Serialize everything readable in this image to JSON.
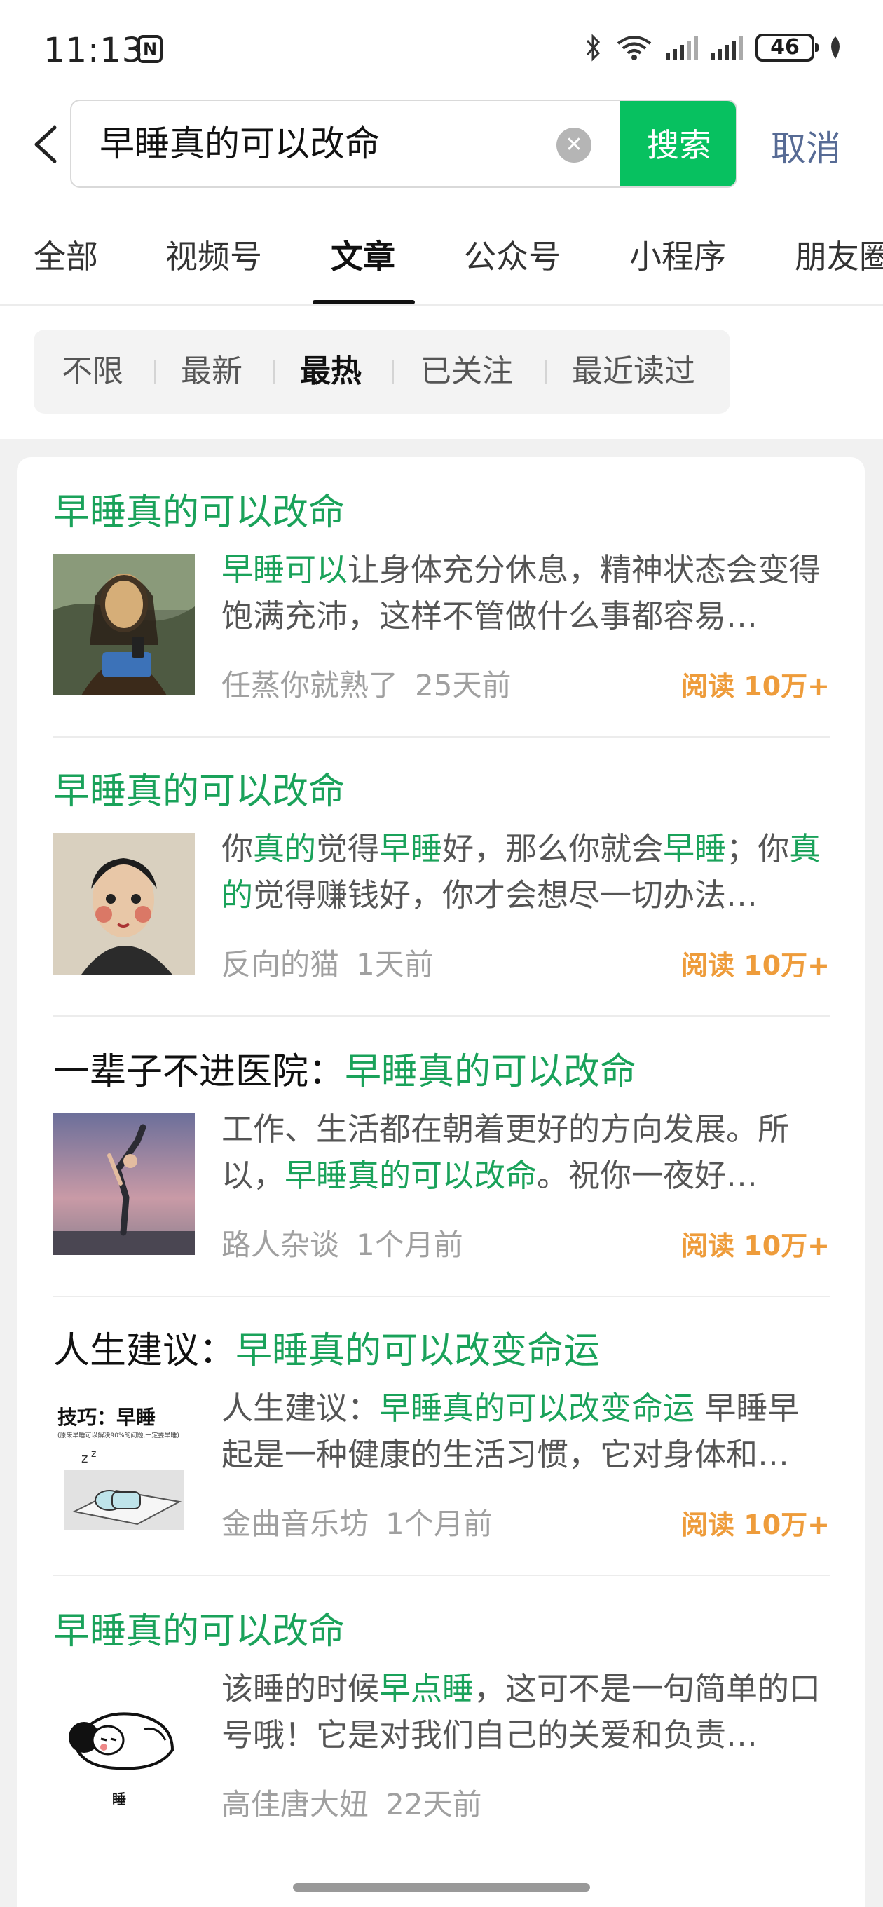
{
  "status": {
    "time": "11:13",
    "nfc": "N",
    "battery": "46"
  },
  "search": {
    "query": "早睡真的可以改命",
    "button": "搜索",
    "cancel": "取消",
    "clear_icon": "clear-icon"
  },
  "tabs": [
    {
      "label": "全部",
      "active": false
    },
    {
      "label": "视频号",
      "active": false
    },
    {
      "label": "文章",
      "active": true
    },
    {
      "label": "公众号",
      "active": false
    },
    {
      "label": "小程序",
      "active": false
    },
    {
      "label": "朋友圈",
      "active": false
    }
  ],
  "filters": [
    "不限",
    "最新",
    "最热",
    "已关注",
    "最近读过"
  ],
  "filter_active": "最热",
  "results": [
    {
      "title": [
        {
          "t": "早睡真的可以改命",
          "hl": true
        }
      ],
      "desc": [
        {
          "t": "早睡可以",
          "hl": true
        },
        {
          "t": "让身体充分休息，精神状态会变得饱满充沛，这样不管做什么事都容易…",
          "hl": false
        }
      ],
      "author": "任蒸你就熟了",
      "time": "25天前",
      "reads": "阅读 10万+",
      "thumb": "mona-lisa-image"
    },
    {
      "title": [
        {
          "t": "早睡真的可以改命",
          "hl": true
        }
      ],
      "desc": [
        {
          "t": "你",
          "hl": false
        },
        {
          "t": "真的",
          "hl": true
        },
        {
          "t": "觉得",
          "hl": false
        },
        {
          "t": "早睡",
          "hl": true
        },
        {
          "t": "好，那么你就会",
          "hl": false
        },
        {
          "t": "早睡",
          "hl": true
        },
        {
          "t": "；你",
          "hl": false
        },
        {
          "t": "真的",
          "hl": true
        },
        {
          "t": "觉得赚钱好，你才会想尽一切办法…",
          "hl": false
        }
      ],
      "author": "反向的猫",
      "time": "1天前",
      "reads": "阅读 10万+",
      "thumb": "portrait-painting-image"
    },
    {
      "title": [
        {
          "t": "一辈子不进医院：",
          "hl": false
        },
        {
          "t": "早睡真的可以改命",
          "hl": true
        }
      ],
      "desc": [
        {
          "t": "工作、生活都在朝着更好的方向发展。所以，",
          "hl": false
        },
        {
          "t": "早睡真的可以改命",
          "hl": true
        },
        {
          "t": "。祝你一夜好…",
          "hl": false
        }
      ],
      "author": "路人杂谈",
      "time": "1个月前",
      "reads": "阅读 10万+",
      "thumb": "yoga-pose-image"
    },
    {
      "title": [
        {
          "t": "人生建议：",
          "hl": false
        },
        {
          "t": "早睡真的可以改变命运",
          "hl": true
        }
      ],
      "desc": [
        {
          "t": "人生建议：",
          "hl": false
        },
        {
          "t": "早睡真的可以改变命运",
          "hl": true
        },
        {
          "t": " 早睡早起是一种健康的生活习惯，它对身体和…",
          "hl": false
        }
      ],
      "author": "金曲音乐坊",
      "time": "1个月前",
      "reads": "阅读 10万+",
      "thumb": "sleep-tips-image",
      "thumb_text": {
        "heading": "技巧：早睡",
        "sub": "(原来早睡可以解决90%的问题,一定要早睡)"
      }
    },
    {
      "title": [
        {
          "t": "早睡真的可以改命",
          "hl": true
        }
      ],
      "desc": [
        {
          "t": "该睡的时候",
          "hl": false
        },
        {
          "t": "早点睡",
          "hl": true
        },
        {
          "t": "，这可不是一句简单的口号哦！它是对我们自己的关爱和负责…",
          "hl": false
        }
      ],
      "author": "高佳唐大妞",
      "time": "22天前",
      "reads": "",
      "thumb": "sleeping-cartoon-image",
      "thumb_text": {
        "caption": "睡"
      }
    }
  ],
  "colors": {
    "accent": "#07c160",
    "highlight": "#1aa25a",
    "reads": "#ee9c3b",
    "link": "#576b95"
  }
}
